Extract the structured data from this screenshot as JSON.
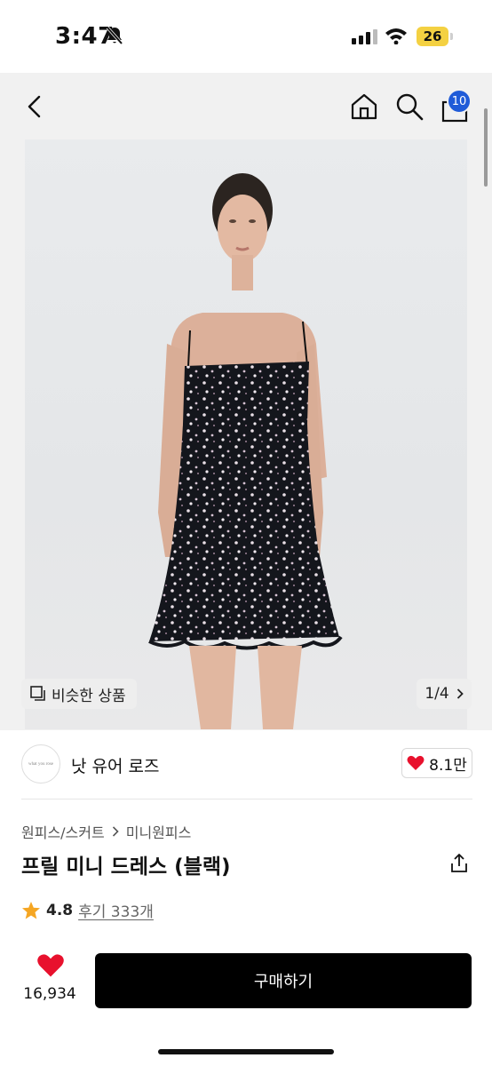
{
  "status_bar": {
    "time": "3:47",
    "battery": "26"
  },
  "nav": {
    "cart_count": "10"
  },
  "image": {
    "similar_label": "비슷한 상품",
    "pager": "1/4"
  },
  "seller": {
    "avatar_text": "what you rose",
    "name": "낫 유어 로즈",
    "likes": "8.1만"
  },
  "product": {
    "breadcrumb": [
      "원피스/스커트",
      "미니원피스"
    ],
    "title": "프릴 미니 드레스 (블랙)",
    "rating": "4.8",
    "reviews": "후기 333개"
  },
  "bottom": {
    "wish_count": "16,934",
    "buy_label": "구매하기"
  },
  "colors": {
    "accent_badge": "#1f5bd8",
    "heart": "#e8112d",
    "star": "#f5a623",
    "buy_button": "#000000"
  },
  "icons": [
    "bell-slash-icon",
    "signal-icon",
    "wifi-icon",
    "battery-icon",
    "back-icon",
    "home-icon",
    "search-icon",
    "bag-icon",
    "similar-icon",
    "chevron-right-icon",
    "heart-icon",
    "share-icon",
    "star-icon"
  ]
}
